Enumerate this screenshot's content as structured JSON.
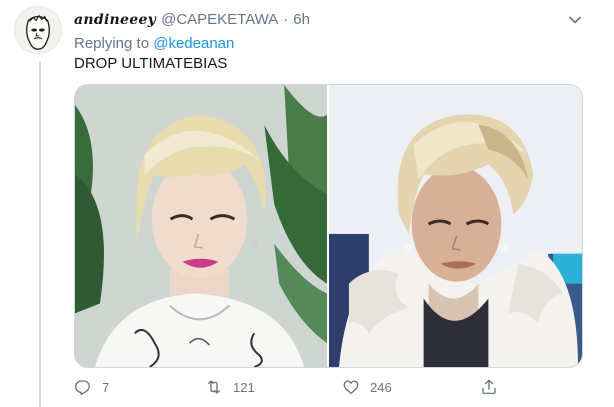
{
  "tweet": {
    "display_name": "andineeey",
    "handle": "@CAPEKETAWA",
    "separator": "·",
    "time": "6h",
    "replying_prefix": "Replying to",
    "replying_to": "@kedeanan",
    "text": "DROP ULTIMATEBIAS"
  },
  "actions": {
    "reply_count": "7",
    "retweet_count": "121",
    "like_count": "246"
  },
  "colors": {
    "link": "#1b95e0",
    "muted": "#657786",
    "text": "#14171a",
    "thread_line": "#ccd6dd"
  },
  "icons": {
    "caret": "chevron-down-icon",
    "reply": "reply-icon",
    "retweet": "retweet-icon",
    "like": "heart-icon",
    "share": "share-icon"
  }
}
